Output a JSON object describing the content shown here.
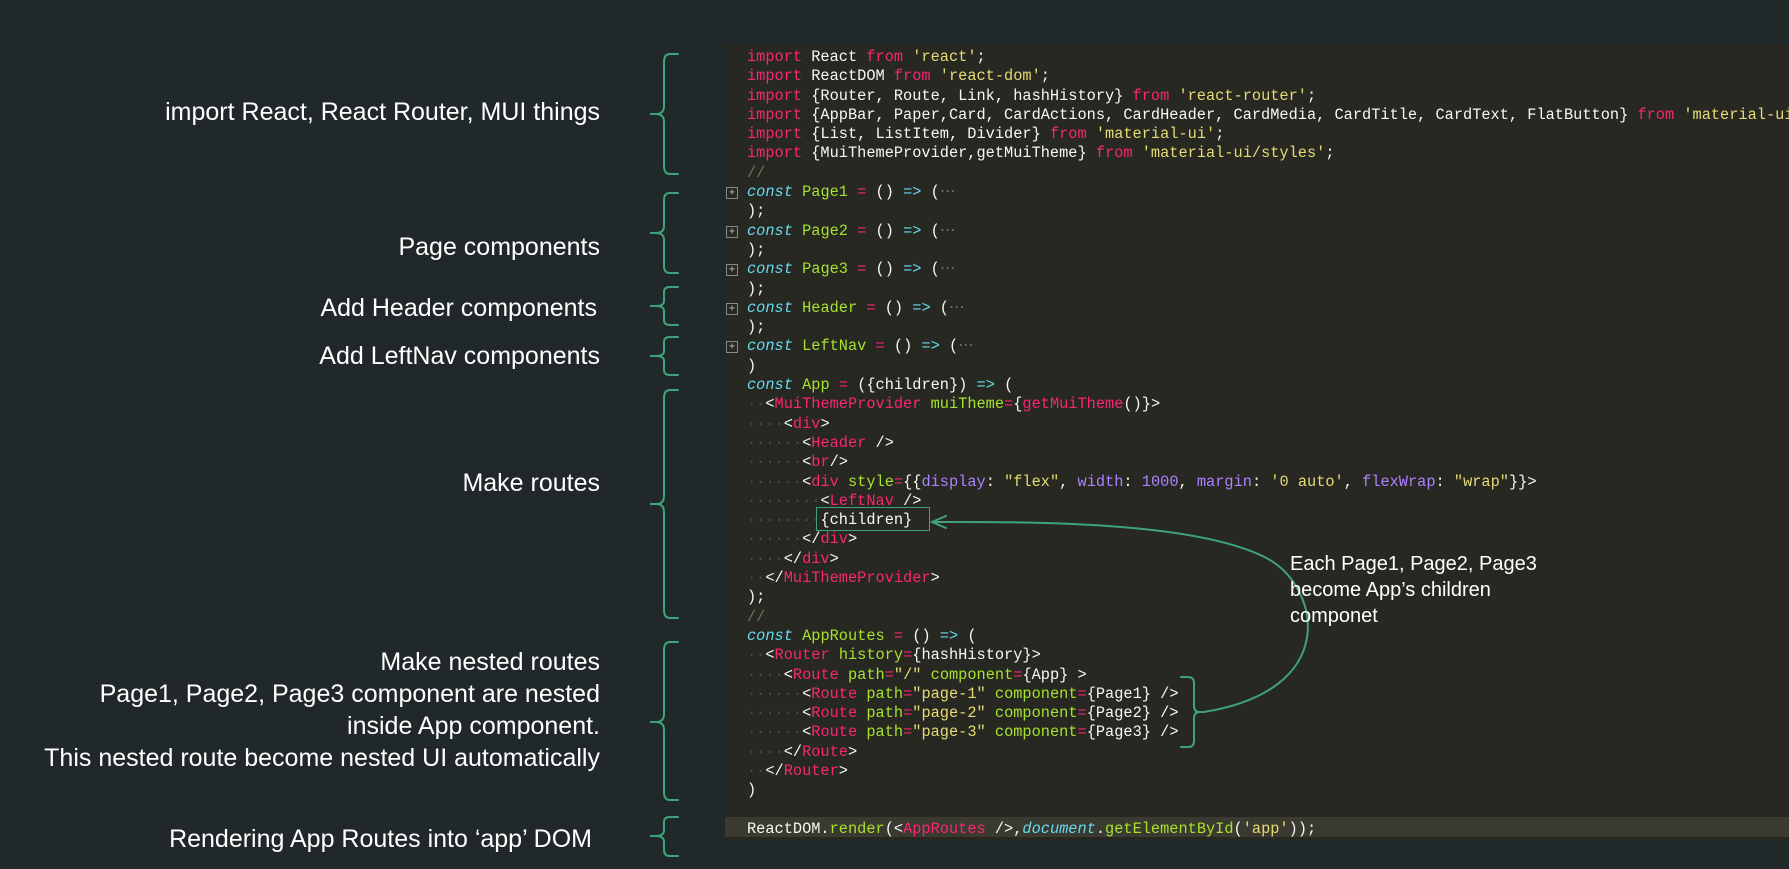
{
  "annotations": [
    {
      "id": "imports",
      "text": "import React, React Router, MUI things"
    },
    {
      "id": "pages",
      "text": "Page components"
    },
    {
      "id": "header",
      "text": "Add Header components"
    },
    {
      "id": "leftnav",
      "text": "Add LeftNav components"
    },
    {
      "id": "routes",
      "text": "Make routes"
    },
    {
      "id": "nested",
      "lines": [
        "Make nested routes",
        "Page1, Page2, Page3 component are nested",
        "inside App component.",
        "This nested route become nested UI automatically"
      ]
    },
    {
      "id": "render",
      "text": "Rendering App Routes into ‘app’ DOM"
    }
  ],
  "note": {
    "lines": [
      "Each Page1, Page2, Page3",
      "become App’s children",
      "componet"
    ]
  },
  "code_lines": [
    "import React from 'react';",
    "import ReactDOM from 'react-dom';",
    "import {Router, Route, Link, hashHistory} from 'react-router';",
    "import {AppBar, Paper,Card, CardActions, CardHeader, CardMedia, CardTitle, CardText, FlatButton} from 'material-ui';",
    "import {List, ListItem, Divider} from 'material-ui';",
    "import {MuiThemeProvider,getMuiTheme} from 'material-ui/styles';",
    "//",
    "const Page1 = () => (⋯",
    ");",
    "const Page2 = () => (⋯",
    ");",
    "const Page3 = () => (⋯",
    ");",
    "const Header = () => (⋯",
    ");",
    "const LeftNav = () => (⋯",
    ")",
    "const App = ({children}) => (",
    "  <MuiThemeProvider muiTheme={getMuiTheme()}>",
    "    <div>",
    "      <Header />",
    "      <br/>",
    "      <div style={{display: \"flex\", width: 1000, margin: '0 auto', flexWrap: \"wrap\"}}>",
    "        <LeftNav />",
    "        {children}",
    "      </div>",
    "    </div>",
    "  </MuiThemeProvider>",
    ");",
    "//",
    "const AppRoutes = () => (",
    "  <Router history={hashHistory}>",
    "    <Route path=\"/\" component={App} >",
    "      <Route path=\"page-1\" component={Page1} />",
    "      <Route path=\"page-2\" component={Page2} />",
    "      <Route path=\"page-3\" component={Page3} />",
    "    </Route>",
    "  </Router>",
    ")",
    "",
    "ReactDOM.render(<AppRoutes />,document.getElementById('app'));"
  ],
  "colors": {
    "background": "#20282a",
    "code_background": "#272822",
    "bracket": "#3fa37a",
    "keyword": "#f92672",
    "string": "#e6db74",
    "function_name": "#a6e22e",
    "storage": "#66d9ef",
    "comment": "#75715e"
  },
  "icons": {
    "fold": "expand-plus-icon"
  }
}
